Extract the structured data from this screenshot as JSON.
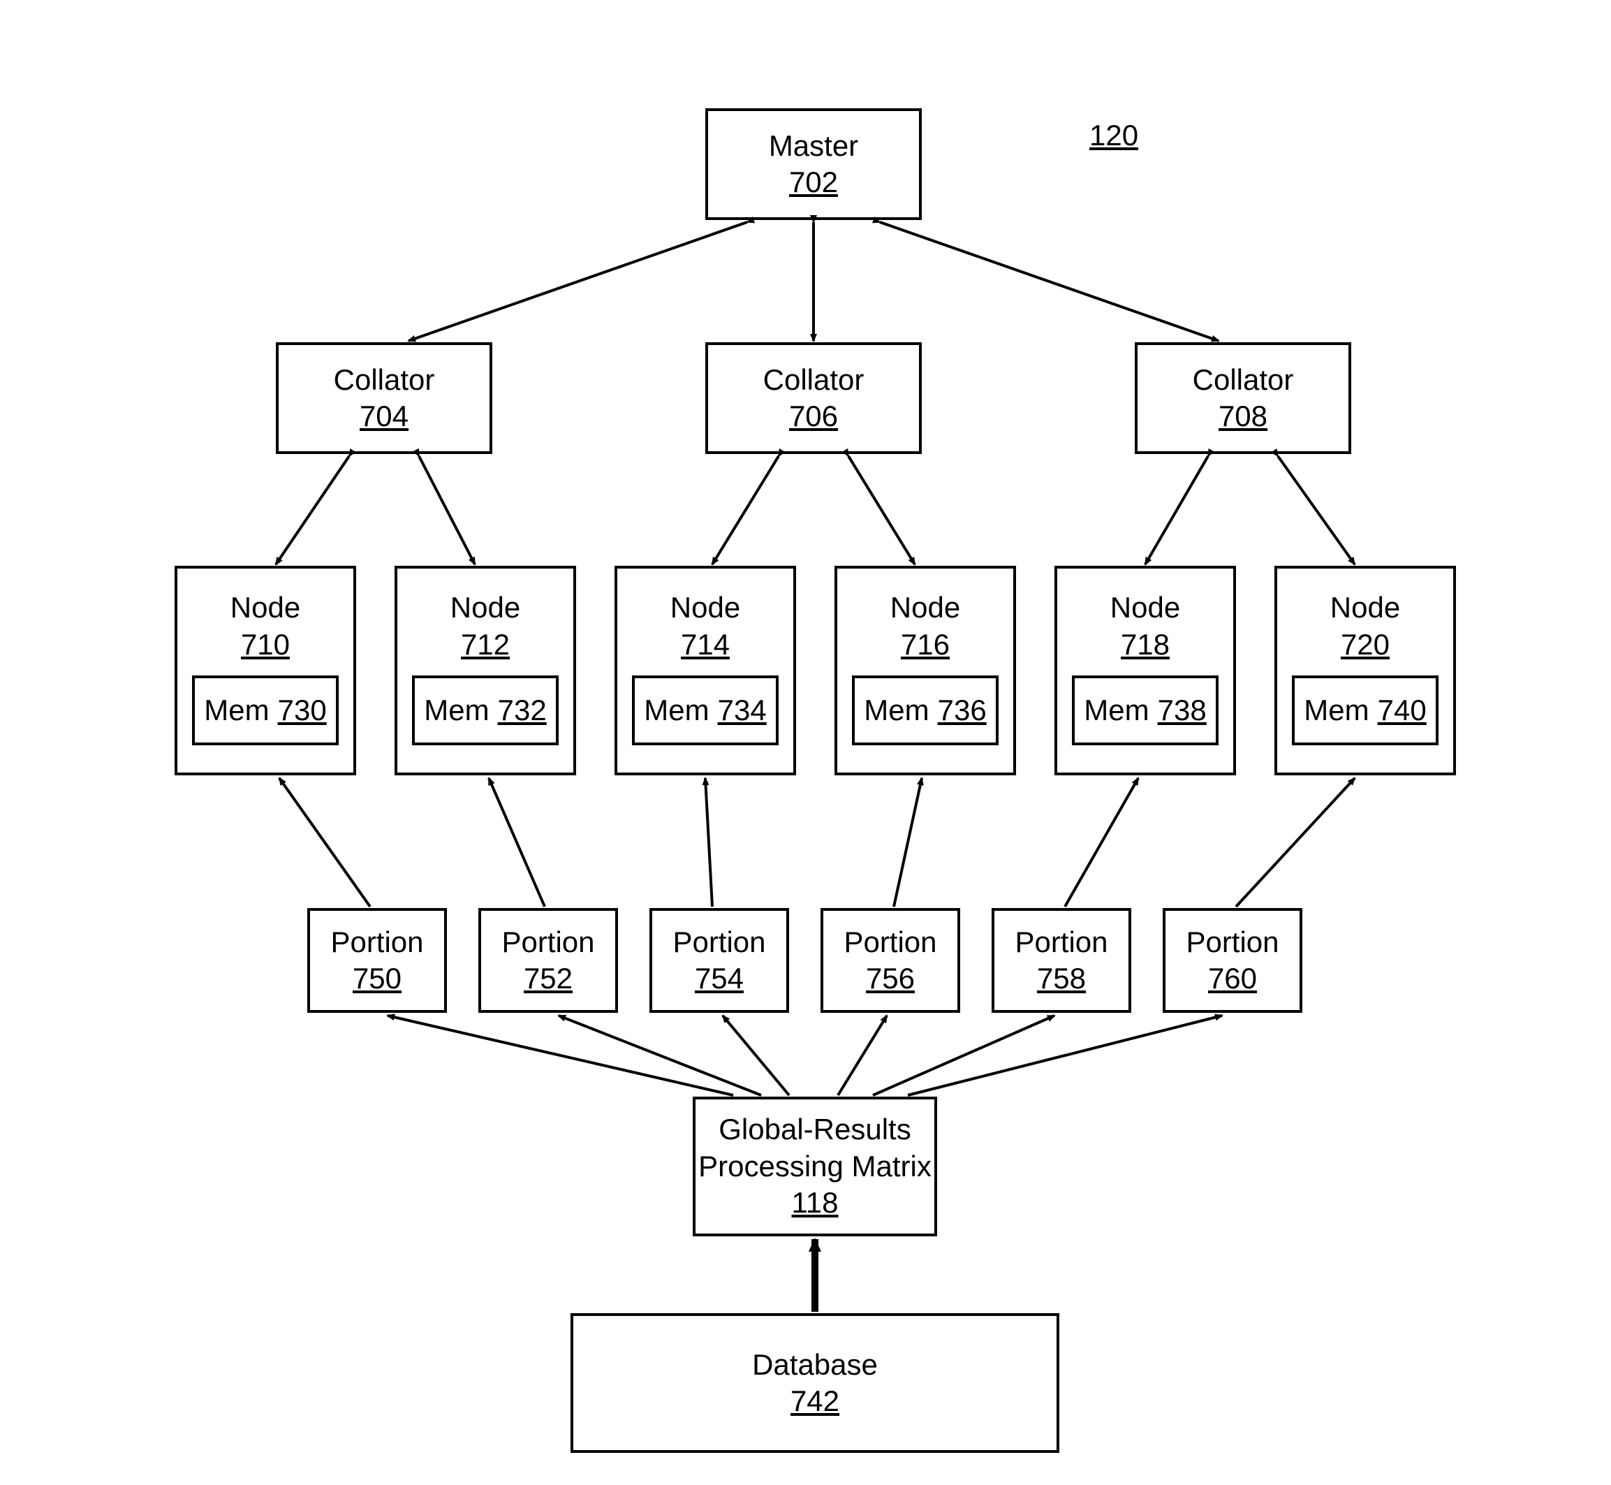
{
  "figure_ref": "120",
  "master": {
    "label": "Master",
    "ref": "702"
  },
  "collators": [
    {
      "label": "Collator",
      "ref": "704"
    },
    {
      "label": "Collator",
      "ref": "706"
    },
    {
      "label": "Collator",
      "ref": "708"
    }
  ],
  "nodes": [
    {
      "label": "Node",
      "ref": "710",
      "mem_label": "Mem",
      "mem_ref": "730"
    },
    {
      "label": "Node",
      "ref": "712",
      "mem_label": "Mem",
      "mem_ref": "732"
    },
    {
      "label": "Node",
      "ref": "714",
      "mem_label": "Mem",
      "mem_ref": "734"
    },
    {
      "label": "Node",
      "ref": "716",
      "mem_label": "Mem",
      "mem_ref": "736"
    },
    {
      "label": "Node",
      "ref": "718",
      "mem_label": "Mem",
      "mem_ref": "738"
    },
    {
      "label": "Node",
      "ref": "720",
      "mem_label": "Mem",
      "mem_ref": "740"
    }
  ],
  "portions": [
    {
      "label": "Portion",
      "ref": "750"
    },
    {
      "label": "Portion",
      "ref": "752"
    },
    {
      "label": "Portion",
      "ref": "754"
    },
    {
      "label": "Portion",
      "ref": "756"
    },
    {
      "label": "Portion",
      "ref": "758"
    },
    {
      "label": "Portion",
      "ref": "760"
    }
  ],
  "grpm": {
    "line1": "Global-Results",
    "line2": "Processing Matrix",
    "ref": "118"
  },
  "database": {
    "label": "Database",
    "ref": "742"
  }
}
